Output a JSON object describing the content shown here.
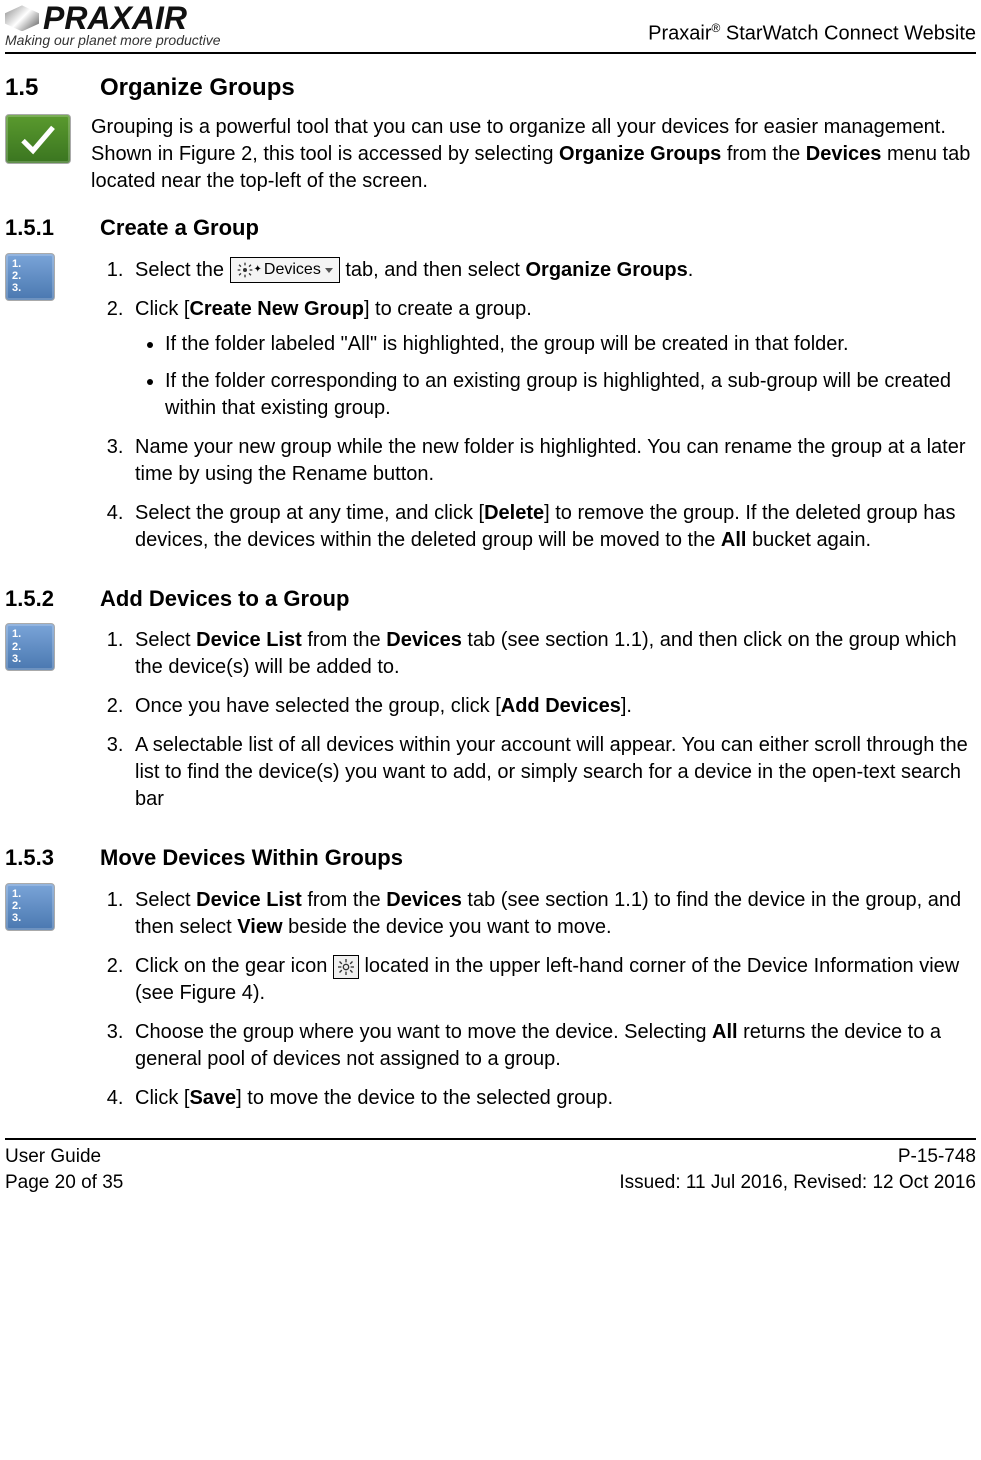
{
  "header": {
    "logo_text": "PRAXAIR",
    "tagline": "Making our planet more productive",
    "title_prefix": "Praxair",
    "title_suffix": " StarWatch Connect Website"
  },
  "s15": {
    "num": "1.5",
    "title": "Organize Groups",
    "intro_a": "Grouping is a powerful tool that you can use to organize all your devices for easier management.  Shown in Figure 2, this tool is accessed by selecting ",
    "intro_b": "Organize Groups",
    "intro_c": " from the ",
    "intro_d": "Devices",
    "intro_e": " menu tab located near the top-left of the screen."
  },
  "s151": {
    "num": "1.5.1",
    "title": "Create a Group",
    "step1_a": "Select the ",
    "tab_label": "Devices",
    "step1_b": " tab, and then select ",
    "step1_c": "Organize Groups",
    "step1_d": ".",
    "step2_a": "Click [",
    "step2_b": "Create New Group",
    "step2_c": "] to create a group.",
    "sub1": "If the folder labeled \"All\" is highlighted, the group will be created in that folder.",
    "sub2": "If the folder corresponding to an existing group is highlighted, a sub-group will be created within that existing group.",
    "step3": "Name your new group while the new folder is highlighted.  You can rename the group at a later time by using the Rename button.",
    "step4_a": "Select the group at any time, and click [",
    "step4_b": "Delete",
    "step4_c": "] to remove the group.  If the deleted group has devices, the devices within the deleted group will be moved to the ",
    "step4_d": "All",
    "step4_e": " bucket again."
  },
  "s152": {
    "num": "1.5.2",
    "title": "Add Devices to a Group",
    "step1_a": "Select ",
    "step1_b": "Device List",
    "step1_c": " from the ",
    "step1_d": "Devices",
    "step1_e": " tab (see section 1.1), and then click on the group which the device(s) will be added to.",
    "step2_a": "Once you have selected the group, click [",
    "step2_b": "Add Devices",
    "step2_c": "].",
    "step3": "A selectable list of all devices within your account will appear.  You can either scroll through the list to find the device(s) you want to add, or simply search for a device in the open-text search bar"
  },
  "s153": {
    "num": "1.5.3",
    "title": "Move Devices Within Groups",
    "step1_a": "Select ",
    "step1_b": "Device List",
    "step1_c": " from the ",
    "step1_d": "Devices",
    "step1_e": " tab (see section 1.1) to find the device in the group, and then select ",
    "step1_f": "View",
    "step1_g": " beside the device you want to move.",
    "step2_a": "Click on the gear icon ",
    "step2_b": " located in the upper left-hand corner of the Device Information view (see Figure 4).",
    "step3_a": "Choose the group where you want to move the device.  Selecting ",
    "step3_b": "All",
    "step3_c": " returns the device to a general pool of devices not assigned to a group.",
    "step4_a": "Click [",
    "step4_b": "Save",
    "step4_c": "] to move the device to the selected group."
  },
  "footer": {
    "left1": "User Guide",
    "left2": "Page 20 of 35",
    "right1": "P-15-748",
    "right2": "Issued:  11 Jul 2016,  Revised:  12 Oct 2016"
  }
}
